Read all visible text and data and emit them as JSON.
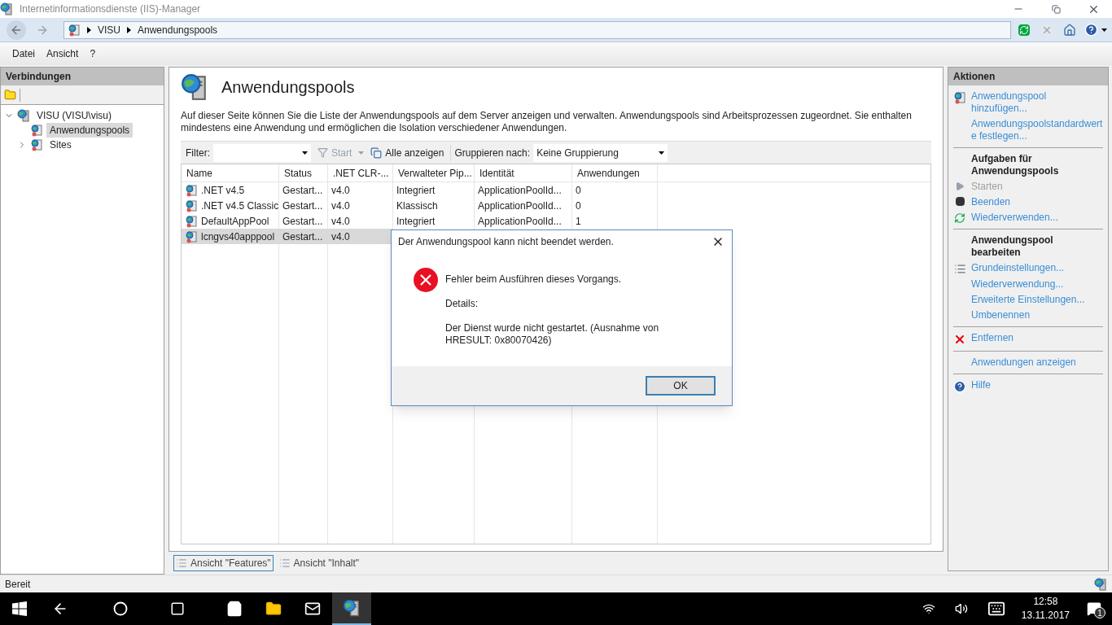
{
  "window": {
    "title": "Internetinformationsdienste (IIS)-Manager"
  },
  "breadcrumb": [
    "VISU",
    "Anwendungspools"
  ],
  "menu": [
    "Datei",
    "Ansicht",
    "?"
  ],
  "connections": {
    "title": "Verbindungen",
    "tree": [
      {
        "label": "VISU (VISU\\visu)",
        "expanded": true,
        "selected": false,
        "children": [
          {
            "label": "Anwendungspools",
            "selected": true
          },
          {
            "label": "Sites",
            "expanded": false,
            "selected": false
          }
        ]
      }
    ]
  },
  "page": {
    "title": "Anwendungspools",
    "description": "Auf dieser Seite können Sie die Liste der Anwendungspools auf dem Server anzeigen und verwalten. Anwendungspools sind Arbeitsprozessen zugeordnet. Sie enthalten mindestens eine Anwendung und ermöglichen die Isolation verschiedener Anwendungen."
  },
  "toolbar": {
    "filter_label": "Filter:",
    "start": "Start",
    "show_all": "Alle anzeigen",
    "group_label": "Gruppieren nach:",
    "group_value": "Keine Gruppierung"
  },
  "table": {
    "columns": [
      "Name",
      "Status",
      ".NET CLR-...",
      "Verwalteter Pip...",
      "Identität",
      "Anwendungen"
    ],
    "rows": [
      {
        "cells": [
          ".NET v4.5",
          "Gestart...",
          "v4.0",
          "Integriert",
          "ApplicationPoolId...",
          "0"
        ],
        "selected": false
      },
      {
        "cells": [
          ".NET v4.5 Classic",
          "Gestart...",
          "v4.0",
          "Klassisch",
          "ApplicationPoolId...",
          "0"
        ],
        "selected": false
      },
      {
        "cells": [
          "DefaultAppPool",
          "Gestart...",
          "v4.0",
          "Integriert",
          "ApplicationPoolId...",
          "1"
        ],
        "selected": false
      },
      {
        "cells": [
          "lcngvs40apppool",
          "Gestart...",
          "v4.0"
        ],
        "selected": true
      }
    ]
  },
  "view_tabs": [
    {
      "label": "Ansicht \"Features\"",
      "selected": true
    },
    {
      "label": "Ansicht \"Inhalt\"",
      "selected": false
    }
  ],
  "actions": {
    "title": "Aktionen",
    "items": [
      {
        "kind": "link",
        "label": "Anwendungspool hinzufügen...",
        "disabled": false
      },
      {
        "kind": "link",
        "label": "Anwendungspoolstandardwerte festlegen...",
        "disabled": false
      },
      {
        "kind": "divider"
      },
      {
        "kind": "heading",
        "label": "Aufgaben für Anwendungspools"
      },
      {
        "kind": "link",
        "label": "Starten",
        "disabled": true
      },
      {
        "kind": "link",
        "label": "Beenden",
        "disabled": false
      },
      {
        "kind": "link",
        "label": "Wiederverwenden...",
        "disabled": false
      },
      {
        "kind": "divider"
      },
      {
        "kind": "heading",
        "label": "Anwendungspool bearbeiten"
      },
      {
        "kind": "link",
        "label": "Grundeinstellungen...",
        "disabled": false
      },
      {
        "kind": "link",
        "label": "Wiederverwendung...",
        "disabled": false
      },
      {
        "kind": "link",
        "label": "Erweiterte Einstellungen...",
        "disabled": false
      },
      {
        "kind": "link",
        "label": "Umbenennen",
        "disabled": false
      },
      {
        "kind": "divider"
      },
      {
        "kind": "link",
        "label": "Entfernen",
        "disabled": false
      },
      {
        "kind": "divider"
      },
      {
        "kind": "link",
        "label": "Anwendungen anzeigen",
        "disabled": false
      },
      {
        "kind": "divider"
      },
      {
        "kind": "link",
        "label": "Hilfe",
        "disabled": false
      }
    ]
  },
  "status_bar": {
    "text": "Bereit"
  },
  "dialog": {
    "title": "Der Anwendungspool kann nicht beendet werden.",
    "message": "Fehler beim Ausführen dieses Vorgangs.",
    "details_label": "Details:",
    "details": "Der Dienst wurde nicht gestartet. (Ausnahme von HRESULT: 0x80070426)",
    "button": "OK"
  },
  "taskbar": {
    "time": "12:58",
    "date": "13.11.2017",
    "notifications": "1"
  }
}
